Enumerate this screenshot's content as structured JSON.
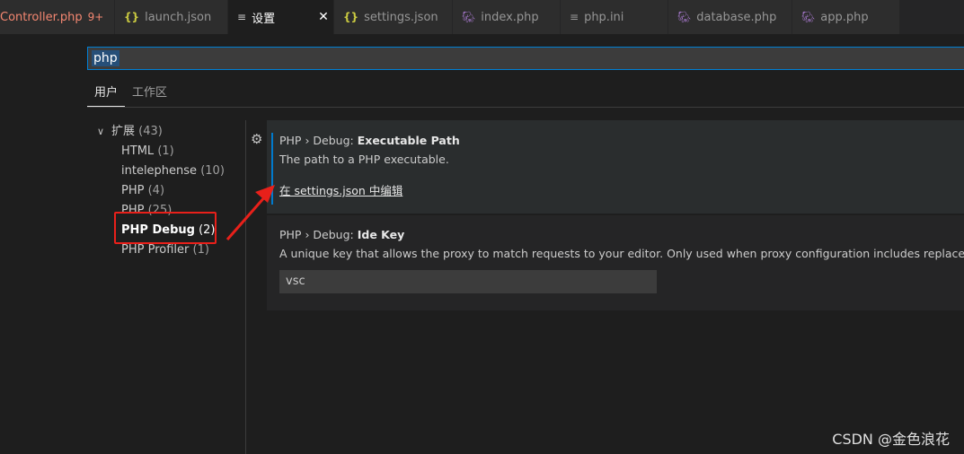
{
  "tabs": [
    {
      "label": "Controller.php",
      "badge": "9+",
      "icon": "php-icon",
      "state": "error"
    },
    {
      "label": "launch.json",
      "icon": "json-icon"
    },
    {
      "label": "设置",
      "icon": "settings-icon",
      "active": true,
      "close": "✕"
    },
    {
      "label": "settings.json",
      "icon": "json-icon"
    },
    {
      "label": "index.php",
      "icon": "php-icon"
    },
    {
      "label": "php.ini",
      "icon": "ini-icon"
    },
    {
      "label": "database.php",
      "icon": "php-icon"
    },
    {
      "label": "app.php",
      "icon": "php-icon"
    }
  ],
  "search": {
    "value": "php"
  },
  "scope_tabs": [
    {
      "label": "用户",
      "active": true
    },
    {
      "label": "工作区"
    }
  ],
  "toc": {
    "group": {
      "label": "扩展",
      "count": "(43)"
    },
    "children": [
      {
        "label": "HTML",
        "count": "(1)"
      },
      {
        "label": "intelephense",
        "count": "(10)"
      },
      {
        "label": "PHP",
        "count": "(4)"
      },
      {
        "label": "PHP",
        "count": "(25)"
      },
      {
        "label": "PHP Debug",
        "count": "(2)",
        "selected": true
      },
      {
        "label": "PHP Profiler",
        "count": "(1)"
      }
    ]
  },
  "settings": [
    {
      "category": "PHP › Debug: ",
      "key": "Executable Path",
      "description": "The path to a PHP executable.",
      "link": "在 settings.json 中编辑"
    },
    {
      "category": "PHP › Debug: ",
      "key": "Ide Key",
      "description": "A unique key that allows the proxy to match requests to your editor. Only used when proxy configuration includes replacement.",
      "value": "vsc"
    }
  ],
  "watermark": "CSDN @金色浪花",
  "colors": {
    "accent": "#007acc",
    "annotation": "#e8201a"
  }
}
